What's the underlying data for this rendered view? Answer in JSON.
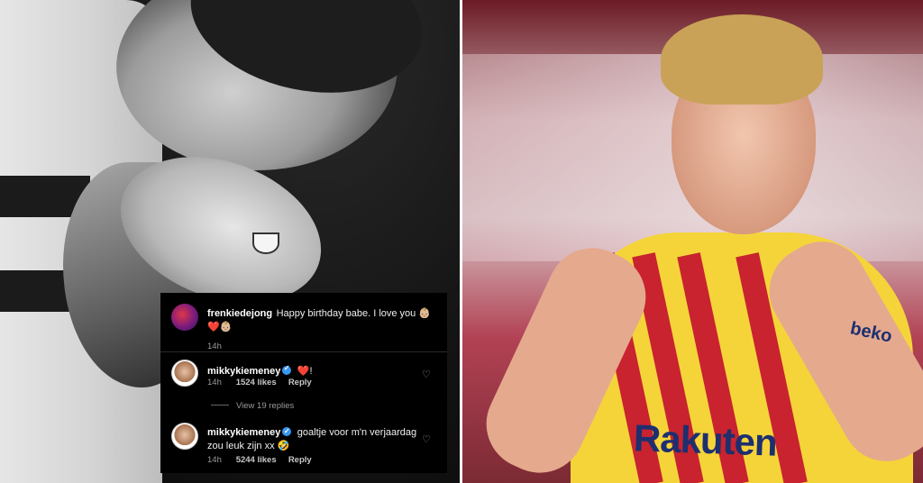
{
  "comments": [
    {
      "username": "frenkiedejong",
      "text": "Happy birthday babe. I love you 👶🏼",
      "text2": "❤️👶🏼",
      "time": "14h"
    },
    {
      "username": "mikkykiemeney",
      "text": "❤️!",
      "time": "14h",
      "likes": "1524 likes",
      "reply": "Reply",
      "view_replies": "View 19 replies"
    },
    {
      "username": "mikkykiemeney",
      "text": "goaltje voor m'n verjaardag",
      "text2": "zou leuk zijn xx 🤣",
      "time": "14h",
      "likes": "5244 likes",
      "reply": "Reply"
    }
  ],
  "jersey": {
    "sponsor": "Rakuten",
    "sleeve": "beko"
  },
  "icons": {
    "verified": "verified-badge-icon",
    "like": "heart-outline-icon"
  },
  "colors": {
    "jersey_yellow": "#f5d43a",
    "jersey_red": "#c8232f",
    "verified_blue": "#3897f0"
  }
}
